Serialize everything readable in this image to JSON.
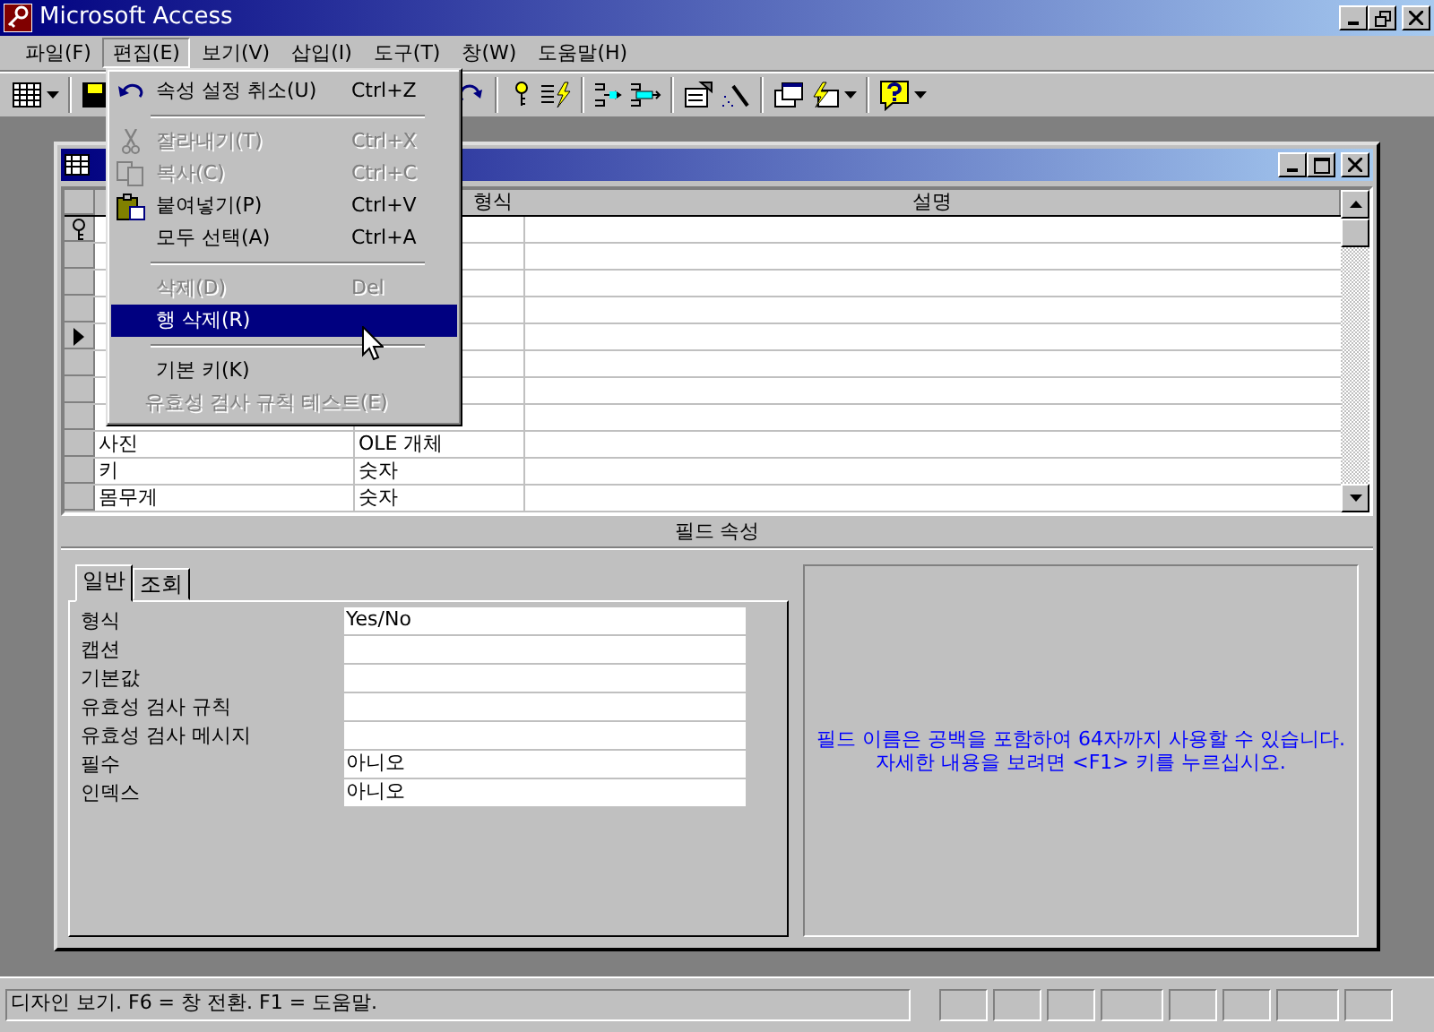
{
  "window": {
    "title": "Microsoft Access"
  },
  "menu_bar": [
    {
      "label": "파일(F)",
      "selected": false
    },
    {
      "label": "편집(E)",
      "selected": true
    },
    {
      "label": "보기(V)",
      "selected": false
    },
    {
      "label": "삽입(I)",
      "selected": false
    },
    {
      "label": "도구(T)",
      "selected": false
    },
    {
      "label": "창(W)",
      "selected": false
    },
    {
      "label": "도움말(H)",
      "selected": false
    }
  ],
  "edit_menu": [
    {
      "kind": "item",
      "label": "속성 설정 취소(U)",
      "shortcut": "Ctrl+Z",
      "disabled": false,
      "selected": false
    },
    {
      "kind": "separator"
    },
    {
      "kind": "item",
      "label": "잘라내기(T)",
      "shortcut": "Ctrl+X",
      "disabled": true,
      "selected": false
    },
    {
      "kind": "item",
      "label": "복사(C)",
      "shortcut": "Ctrl+C",
      "disabled": true,
      "selected": false
    },
    {
      "kind": "item",
      "label": "붙여넣기(P)",
      "shortcut": "Ctrl+V",
      "disabled": false,
      "selected": false
    },
    {
      "kind": "item",
      "label": "모두 선택(A)",
      "shortcut": "Ctrl+A",
      "disabled": false,
      "selected": false
    },
    {
      "kind": "separator"
    },
    {
      "kind": "item",
      "label": "삭제(D)",
      "shortcut": "Del",
      "disabled": true,
      "selected": false
    },
    {
      "kind": "item",
      "label": "행 삭제(R)",
      "disabled": false,
      "selected": true
    },
    {
      "kind": "separator"
    },
    {
      "kind": "item",
      "label": "기본 키(K)",
      "disabled": false,
      "selected": false
    },
    {
      "kind": "item",
      "label": "유효성 검사 규칙 테스트(E)",
      "disabled": true,
      "selected": false
    }
  ],
  "table": {
    "columns": [
      "형식",
      "설명"
    ],
    "rows": [
      {
        "primary_key": true,
        "current": false
      },
      {
        "primary_key": false,
        "current": false
      },
      {
        "primary_key": false,
        "current": false
      },
      {
        "primary_key": false,
        "current": false
      },
      {
        "primary_key": false,
        "current": true
      },
      {
        "primary_key": false,
        "current": false
      },
      {
        "primary_key": false,
        "current": false
      },
      {
        "primary_key": false,
        "current": false
      },
      {
        "primary_key": false,
        "current": false,
        "field_name": "사진",
        "data_type": "OLE 개체"
      },
      {
        "primary_key": false,
        "current": false,
        "field_name": "키",
        "data_type": "숫자"
      },
      {
        "primary_key": false,
        "current": false,
        "field_name": "몸무게",
        "data_type": "숫자"
      }
    ]
  },
  "field_properties": {
    "title": "필드 속성",
    "tabs": [
      {
        "label": "일반",
        "selected": true
      },
      {
        "label": "조회",
        "selected": false
      }
    ],
    "properties": [
      {
        "label": "형식",
        "value": "Yes/No"
      },
      {
        "label": "캡션"
      },
      {
        "label": "기본값"
      },
      {
        "label": "유효성 검사 규칙"
      },
      {
        "label": "유효성 검사 메시지"
      },
      {
        "label": "필수",
        "value": "아니오"
      },
      {
        "label": "인덱스",
        "value": "아니오"
      }
    ],
    "help_text": "필드 이름은 공백을 포함하여 64자까지 사용할 수 있습니다. 자세한 내용을 보려면 <F1> 키를 누르십시오."
  },
  "status_bar": {
    "text": "디자인 보기.  F6 = 창 전환.  F1 = 도움말."
  }
}
